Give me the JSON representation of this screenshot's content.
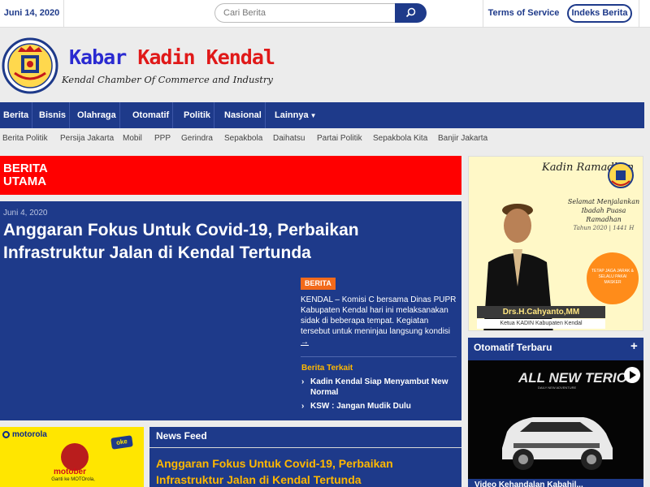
{
  "topbar": {
    "date": "Juni 14, 2020",
    "search_placeholder": "Cari Berita",
    "terms_label": "Terms of Service",
    "index_label": "Indeks Berita"
  },
  "header": {
    "title_part1": "Kabar",
    "title_part2": "Kadin",
    "title_part3": "Kendal",
    "subtitle": "Kendal Chamber Of Commerce and Industry",
    "logo_text": "KADIN KENDAL"
  },
  "nav": {
    "items": [
      "Berita",
      "Bisnis",
      "Olahraga",
      "Otomatif",
      "Politik",
      "Nasional",
      "Lainnya"
    ]
  },
  "tags": [
    "Berita Politik",
    "Persija Jakarta",
    "Mobil",
    "PPP",
    "Gerindra",
    "Sepakbola",
    "Daihatsu",
    "Partai Politik",
    "Sepakbola Kita",
    "Banjir Jakarta"
  ],
  "breaking": {
    "label": "BERITA UTAMA"
  },
  "featured": {
    "date": "Juni 4, 2020",
    "title": "Anggaran Fokus Untuk Covid-19, Perbaikan Infrastruktur Jalan di Kendal Tertunda",
    "category": "BERITA",
    "excerpt": "KENDAL – Komisi C bersama Dinas PUPR Kabupaten Kendal hari ini melaksanakan sidak di beberapa tempat. Kegiatan tersebut untuk meninjau langsung kondisi ",
    "read_more": "→",
    "related_heading": "Berita Terkait",
    "related": [
      "Kadin Kendal Siap Menyambut New Normal",
      "KSW : Jangan Mudik Dulu"
    ]
  },
  "ad_motorola": {
    "brand": "motorola",
    "campaign": "motober",
    "tagline": "Ganti ke MOTOrola,",
    "partner": "oke"
  },
  "news_feed": {
    "heading": "News Feed",
    "first_title": "Anggaran Fokus Untuk Covid-19, Perbaikan Infrastruktur Jalan di Kendal Tertunda"
  },
  "ad_ramadhan": {
    "logo_text": "Kadin Ramadhan",
    "greeting_line1": "Selamat Menjalankan",
    "greeting_line2": "Ibadah Puasa Ramadhan",
    "greeting_line3": "Tahun 2020 | 1441 H",
    "covid_text": "TETAP JAGA JARAK & SELALU PAKAI MASKER",
    "name": "Drs.H.Cahyanto,MM",
    "role": "Ketua KADIN Kabupaten Kendal"
  },
  "otomatif": {
    "heading": "Otomatif Terbaru",
    "plus": "+",
    "image_brand": "ALL NEW TERIOS",
    "image_sub": "DAILY NEW ADVENTURE",
    "caption": "Video Kehandalan Kabahil..."
  }
}
